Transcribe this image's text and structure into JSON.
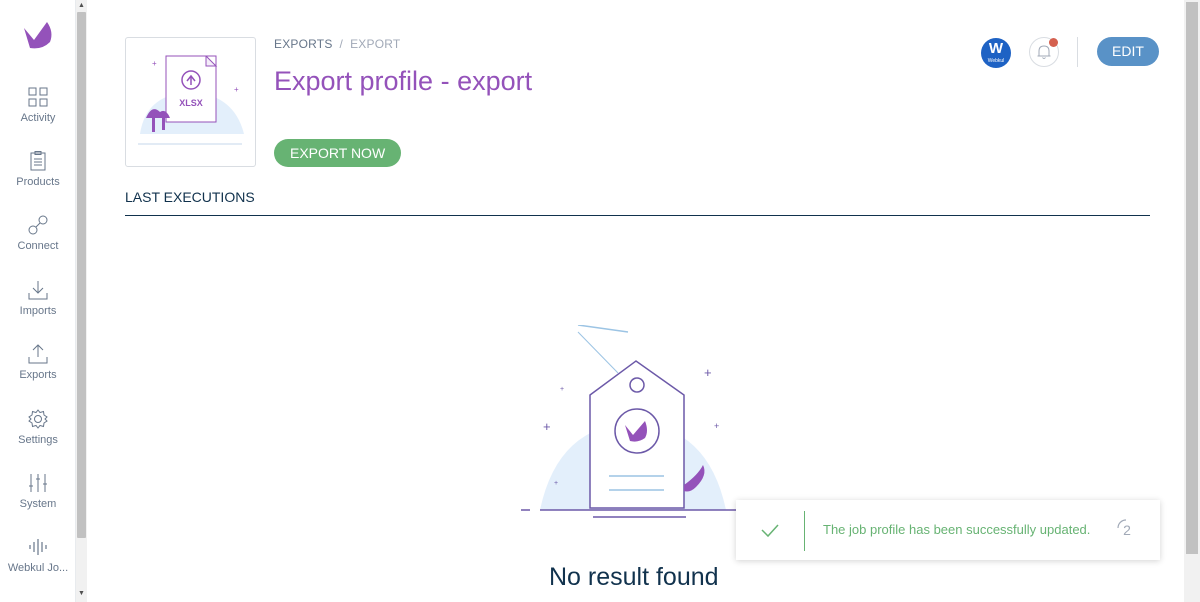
{
  "sidebar": {
    "items": [
      {
        "label": "Activity",
        "icon": "activity-icon"
      },
      {
        "label": "Products",
        "icon": "products-icon"
      },
      {
        "label": "Connect",
        "icon": "connect-icon"
      },
      {
        "label": "Imports",
        "icon": "imports-icon"
      },
      {
        "label": "Exports",
        "icon": "exports-icon"
      },
      {
        "label": "Settings",
        "icon": "settings-icon"
      },
      {
        "label": "System",
        "icon": "system-icon"
      },
      {
        "label": "Webkul Jo...",
        "icon": "webkul-job-icon"
      }
    ]
  },
  "header": {
    "breadcrumb": {
      "root": "EXPORTS",
      "separator": "/",
      "current": "EXPORT"
    },
    "title": "Export profile - export",
    "export_now_label": "EXPORT NOW",
    "thumbnail_label": "XLSX",
    "avatar_letter": "W",
    "avatar_caption": "Webkul",
    "edit_label": "EDIT"
  },
  "section": {
    "title": "LAST EXECUTIONS",
    "empty_text": "No result found"
  },
  "toast": {
    "message": "The job profile has been successfully updated.",
    "countdown": "2"
  },
  "colors": {
    "brand_purple": "#9452ba",
    "success_green": "#67b373",
    "primary_blue": "#5992c7",
    "text_dark": "#11324d",
    "notification_red": "#d4604f"
  }
}
